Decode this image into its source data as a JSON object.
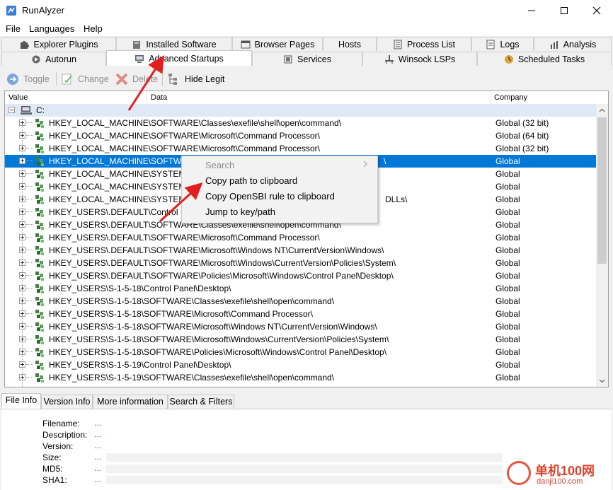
{
  "window": {
    "title": "RunAlyzer"
  },
  "menu": [
    "File",
    "Languages",
    "Help"
  ],
  "tabs_top": [
    "Explorer Plugins",
    "Installed Software",
    "Browser Pages",
    "Hosts",
    "Process List",
    "Logs",
    "Analysis"
  ],
  "tabs_bottom": [
    "Autorun",
    "Advanced Startups",
    "Services",
    "Winsock LSPs",
    "Scheduled Tasks"
  ],
  "active_tab": "Advanced Startups",
  "toolbar": {
    "toggle": "Toggle",
    "change": "Change",
    "delete": "Delete",
    "hide_legit": "Hide Legit"
  },
  "columns": [
    "Value",
    "Data",
    "Company"
  ],
  "tree_root": "C:",
  "rows": [
    {
      "value": "HKEY_LOCAL_MACHINE\\SOFTWARE\\Classes\\exefile\\shell\\open\\command\\",
      "company": "Global (32 bit)"
    },
    {
      "value": "HKEY_LOCAL_MACHINE\\SOFTWARE\\Microsoft\\Command Processor\\",
      "company": "Global (64 bit)"
    },
    {
      "value": "HKEY_LOCAL_MACHINE\\SOFTWARE\\Microsoft\\Command Processor\\",
      "company": "Global (32 bit)"
    },
    {
      "value": "HKEY_LOCAL_MACHINE\\SOFTWARE\\",
      "value_tail": "\\",
      "company": "Global",
      "selected": true
    },
    {
      "value": "HKEY_LOCAL_MACHINE\\SYSTEM\\C",
      "company": "Global"
    },
    {
      "value": "HKEY_LOCAL_MACHINE\\SYSTEM\\C",
      "company": "Global"
    },
    {
      "value": "HKEY_LOCAL_MACHINE\\SYSTEM\\C",
      "value_tail": "DLLs\\",
      "company": "Global"
    },
    {
      "value": "HKEY_USERS\\.DEFAULT\\Control Pa",
      "company": "Global"
    },
    {
      "value": "HKEY_USERS\\.DEFAULT\\SOFTWARE\\Classes\\exefile\\shell\\open\\command\\",
      "company": "Global"
    },
    {
      "value": "HKEY_USERS\\.DEFAULT\\SOFTWARE\\Microsoft\\Command Processor\\",
      "company": "Global"
    },
    {
      "value": "HKEY_USERS\\.DEFAULT\\SOFTWARE\\Microsoft\\Windows NT\\CurrentVersion\\Windows\\",
      "company": "Global"
    },
    {
      "value": "HKEY_USERS\\.DEFAULT\\SOFTWARE\\Microsoft\\Windows\\CurrentVersion\\Policies\\System\\",
      "company": "Global"
    },
    {
      "value": "HKEY_USERS\\.DEFAULT\\SOFTWARE\\Policies\\Microsoft\\Windows\\Control Panel\\Desktop\\",
      "company": "Global"
    },
    {
      "value": "HKEY_USERS\\S-1-5-18\\Control Panel\\Desktop\\",
      "company": "Global"
    },
    {
      "value": "HKEY_USERS\\S-1-5-18\\SOFTWARE\\Classes\\exefile\\shell\\open\\command\\",
      "company": "Global"
    },
    {
      "value": "HKEY_USERS\\S-1-5-18\\SOFTWARE\\Microsoft\\Command Processor\\",
      "company": "Global"
    },
    {
      "value": "HKEY_USERS\\S-1-5-18\\SOFTWARE\\Microsoft\\Windows NT\\CurrentVersion\\Windows\\",
      "company": "Global"
    },
    {
      "value": "HKEY_USERS\\S-1-5-18\\SOFTWARE\\Microsoft\\Windows\\CurrentVersion\\Policies\\System\\",
      "company": "Global"
    },
    {
      "value": "HKEY_USERS\\S-1-5-18\\SOFTWARE\\Policies\\Microsoft\\Windows\\Control Panel\\Desktop\\",
      "company": "Global"
    },
    {
      "value": "HKEY_USERS\\S-1-5-19\\Control Panel\\Desktop\\",
      "company": "Global"
    },
    {
      "value": "HKEY_USERS\\S-1-5-19\\SOFTWARE\\Classes\\exefile\\shell\\open\\command\\",
      "company": "Global"
    }
  ],
  "context_menu": {
    "search": "Search",
    "copy_path": "Copy path to clipboard",
    "copy_rule": "Copy OpenSBI rule to clipboard",
    "jump": "Jump to key/path"
  },
  "info_tabs": [
    "File Info",
    "Version Info",
    "More information",
    "Search & Filters"
  ],
  "info_fields": [
    {
      "label": "Filename:",
      "value": "..."
    },
    {
      "label": "Description:",
      "value": "..."
    },
    {
      "label": "Version:",
      "value": "..."
    },
    {
      "label": "Size:",
      "value": "..."
    },
    {
      "label": "MD5:",
      "value": "..."
    },
    {
      "label": "SHA1:",
      "value": "..."
    }
  ],
  "watermark": {
    "main": "单机100网",
    "sub": "danji100.com"
  },
  "colors": {
    "selection": "#0078d7",
    "arrow": "#e02020",
    "root_row": "#dfe9f5"
  }
}
